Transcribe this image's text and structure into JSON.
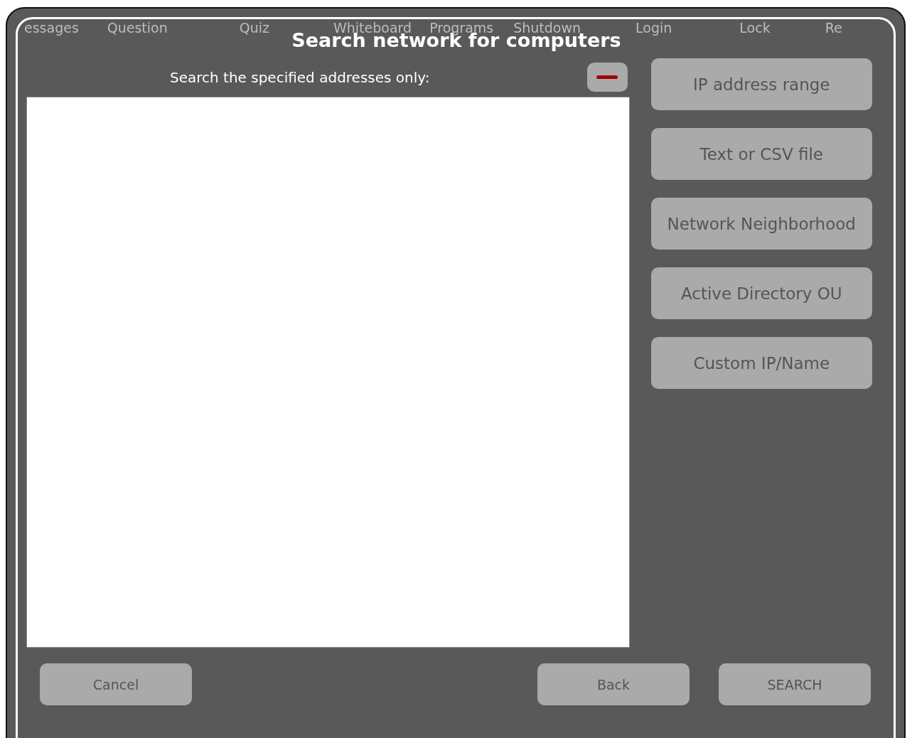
{
  "background_toolbar": [
    "essages",
    "Question",
    "Quiz",
    "Whiteboard",
    "Programs",
    "Shutdown",
    "Login",
    "Lock",
    "Re"
  ],
  "dialog": {
    "title": "Search network for computers",
    "list_label": "Search the specified addresses only:",
    "source_buttons": [
      "IP address range",
      "Text or CSV file",
      "Network Neighborhood",
      "Active Directory OU",
      "Custom IP/Name"
    ],
    "footer_buttons": [
      {
        "label": "Cancel",
        "kind": "left"
      },
      {
        "label": "Back",
        "kind": "right"
      },
      {
        "label": "SEARCH",
        "kind": "right"
      }
    ]
  }
}
